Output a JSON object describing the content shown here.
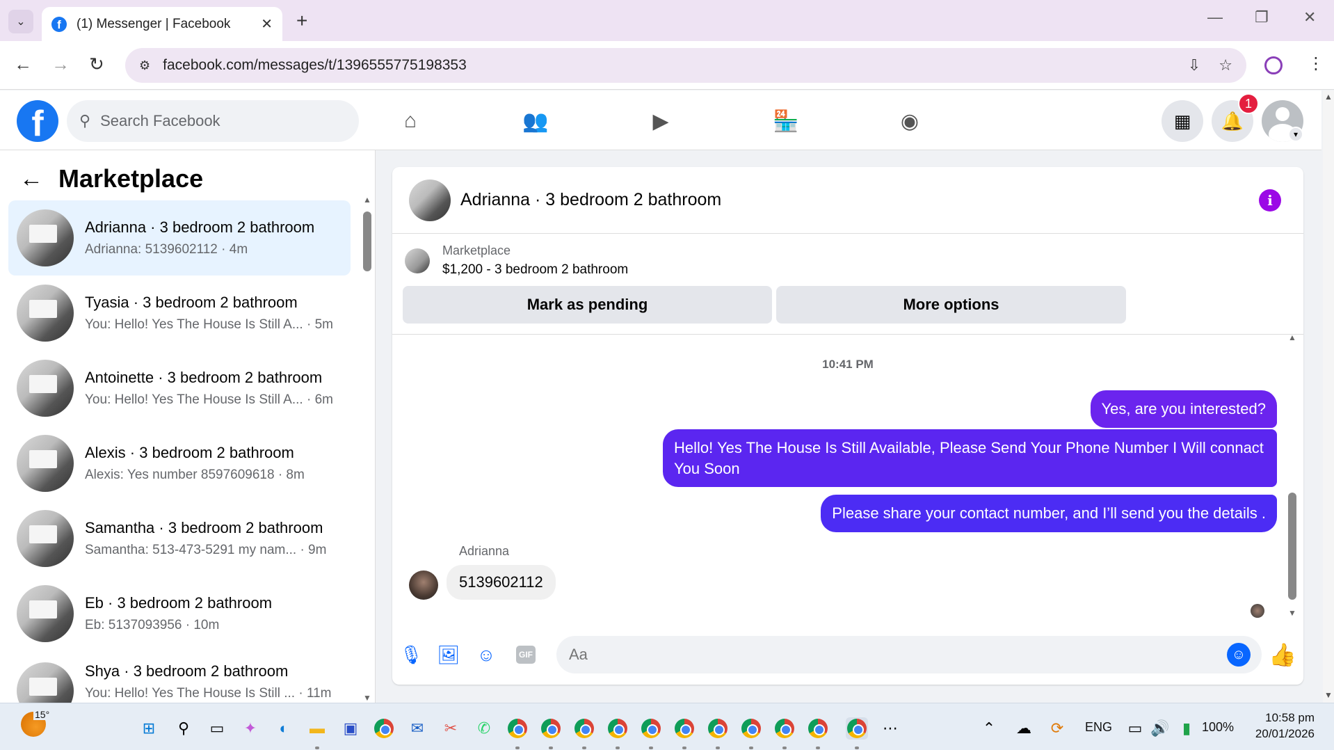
{
  "browser": {
    "tab_title": "(1) Messenger | Facebook",
    "tab_close": "✕",
    "new_tab": "+",
    "url": "facebook.com/messages/t/1396555775198353",
    "back": "←",
    "forward": "→",
    "reload": "↻",
    "minimize": "—",
    "restore": "❐",
    "close": "✕"
  },
  "fbnav": {
    "search_placeholder": "Search Facebook",
    "notification_count": "1"
  },
  "left_panel": {
    "title": "Marketplace",
    "conversations": [
      {
        "name": "Adrianna · 3 bedroom 2 bathroom",
        "preview": "Adrianna: 5139602112 · 4m"
      },
      {
        "name": "Tyasia · 3 bedroom 2 bathroom",
        "preview": "You: Hello! Yes The House Is Still A... · 5m"
      },
      {
        "name": "Antoinette · 3 bedroom 2 bathroom",
        "preview": "You: Hello! Yes The House Is Still A... · 6m"
      },
      {
        "name": "Alexis · 3 bedroom 2 bathroom",
        "preview": "Alexis: Yes number 8597609618 · 8m"
      },
      {
        "name": "Samantha · 3 bedroom 2 bathroom",
        "preview": "Samantha: 513-473-5291 my nam... · 9m"
      },
      {
        "name": "Eb · 3 bedroom 2 bathroom",
        "preview": "Eb: 5137093956 · 10m"
      },
      {
        "name": "Shya · 3 bedroom 2 bathroom",
        "preview": "You: Hello! Yes The House Is Still ... · 11m"
      }
    ]
  },
  "chat": {
    "header_title": "Adrianna · 3 bedroom 2 bathroom",
    "listing_label": "Marketplace",
    "listing_price": "$1,200 - 3 bedroom 2 bathroom",
    "mark_pending": "Mark as pending",
    "more_options": "More options",
    "timestamp": "10:41 PM",
    "messages_out": [
      "Yes, are you interested?",
      "Hello! Yes The House  Is Still Available, Please Send Your Phone Number I Will connact You Soon",
      "Please share your contact number, and I’ll send you the details ."
    ],
    "sender_name": "Adrianna",
    "message_in": "5139602112",
    "input_placeholder": "Aa"
  },
  "taskbar": {
    "temperature": "15°",
    "language": "ENG",
    "battery": "100%",
    "time": "10:58 pm",
    "date": "20/01/2026"
  },
  "colors": {
    "fb_blue": "#1877f2",
    "messenger_blue": "#0866ff",
    "bubble_out": "#5b29f2",
    "info_purple": "#9b09e6",
    "active_conv": "#e7f3ff"
  }
}
